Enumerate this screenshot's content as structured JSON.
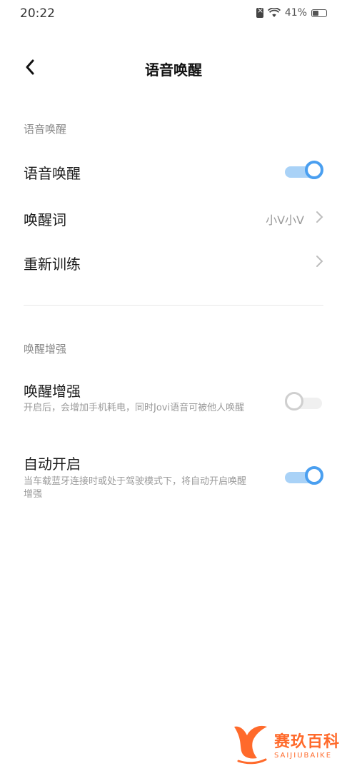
{
  "status_bar": {
    "time": "20:22",
    "battery": "41%"
  },
  "nav": {
    "title": "语音唤醒"
  },
  "section1": {
    "header": "语音唤醒",
    "voice_wake": {
      "title": "语音唤醒",
      "toggle": "on"
    },
    "wake_word": {
      "title": "唤醒词",
      "value": "小V小V"
    },
    "retrain": {
      "title": "重新训练"
    }
  },
  "section2": {
    "header": "唤醒增强",
    "enhance": {
      "title": "唤醒增强",
      "desc": "开启后，会增加手机耗电，同时Jovi语音可被他人唤醒",
      "toggle": "off"
    },
    "auto_on": {
      "title": "自动开启",
      "desc": "当车载蓝牙连接时或处于驾驶模式下，将自动开启唤醒增强",
      "toggle": "on"
    }
  },
  "watermark": {
    "main": "赛玖百科",
    "sub": "SAIJIUBAIKE"
  },
  "colors": {
    "accent": "#4a9ff0",
    "accent_track": "#a9d2f7",
    "watermark": "#ff6a2b"
  }
}
